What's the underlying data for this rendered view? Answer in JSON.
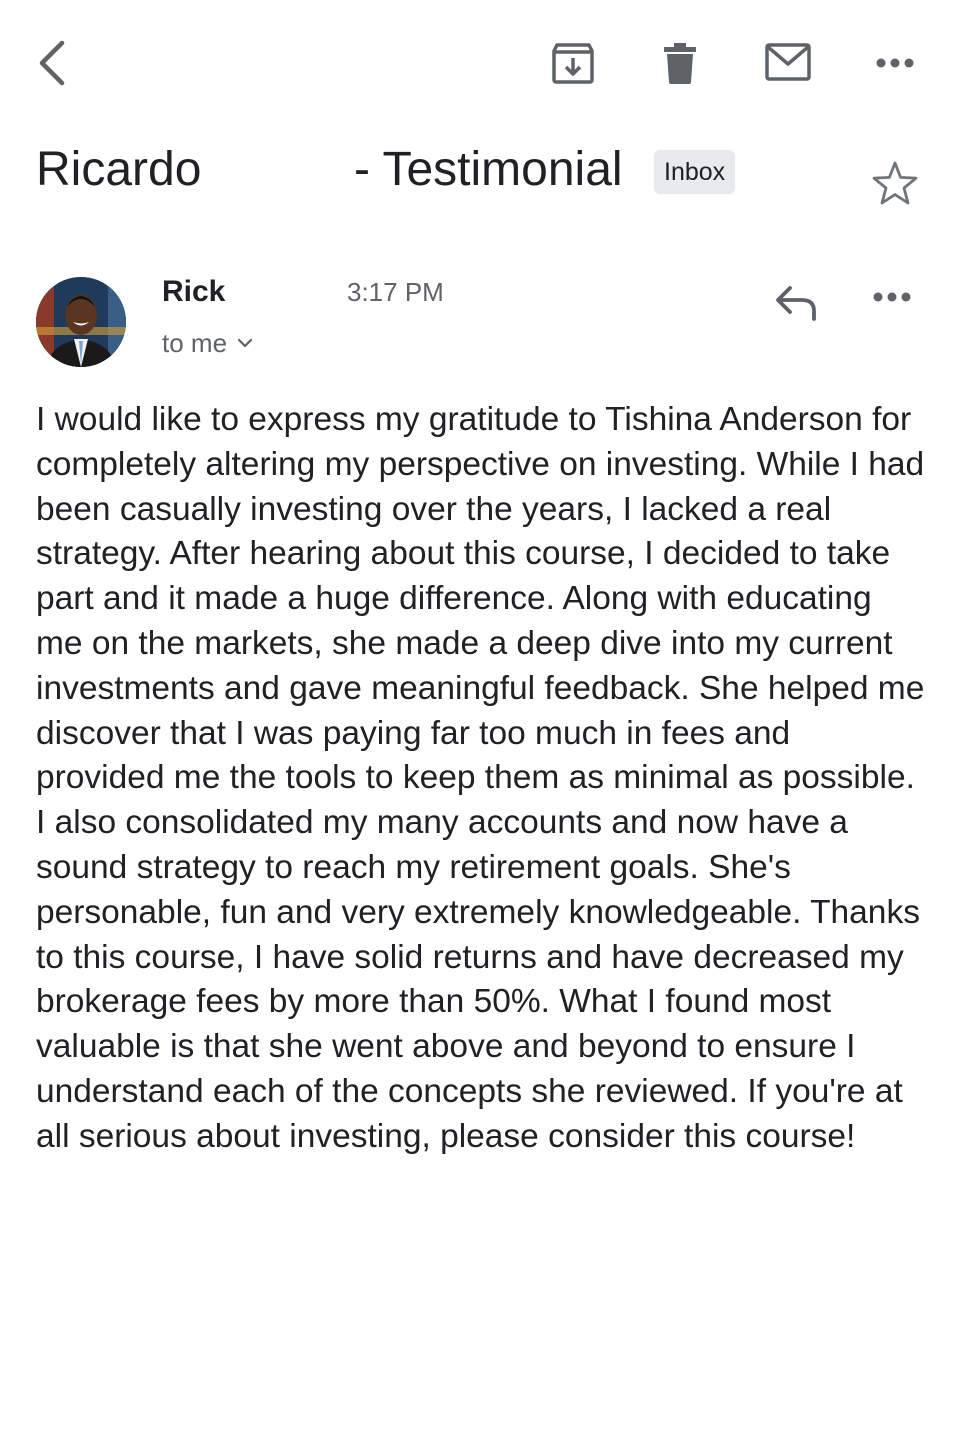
{
  "toolbar": {
    "back_icon": "chevron-left-icon",
    "archive_icon": "archive-icon",
    "delete_icon": "trash-icon",
    "mark_unread_icon": "envelope-icon",
    "more_icon": "more-horizontal-icon"
  },
  "email": {
    "subject_left": "Ricardo",
    "subject_right": "- Testimonial",
    "label": "Inbox",
    "star_icon": "star-outline-icon",
    "sender": "Rick",
    "time": "3:17 PM",
    "recipient": "to me",
    "reply_icon": "reply-icon",
    "body": "I would like to express my gratitude to Tishina Anderson for completely altering my perspective on investing. While I had been casually investing over the years, I lacked a real strategy.  After hearing about this course, I decided to take part and it made a huge difference.  Along with educating me on the markets, she made a deep dive into my current investments and gave meaningful feedback.  She helped me discover that I was paying far too much in fees and provided me the tools to keep them as minimal as possible.  I also consolidated my many accounts and now have a sound strategy to reach my retirement goals.  She's personable, fun and very extremely knowledgeable.  Thanks to this course, I have solid returns and have decreased my brokerage fees by more than 50%.  What I found most valuable is that she went above and beyond to ensure I understand each of the concepts she reviewed.  If you're at all serious about investing, please consider this course!"
  },
  "colors": {
    "icon": "#5f6368",
    "text": "#202124",
    "badge_bg": "#e8eaed"
  }
}
